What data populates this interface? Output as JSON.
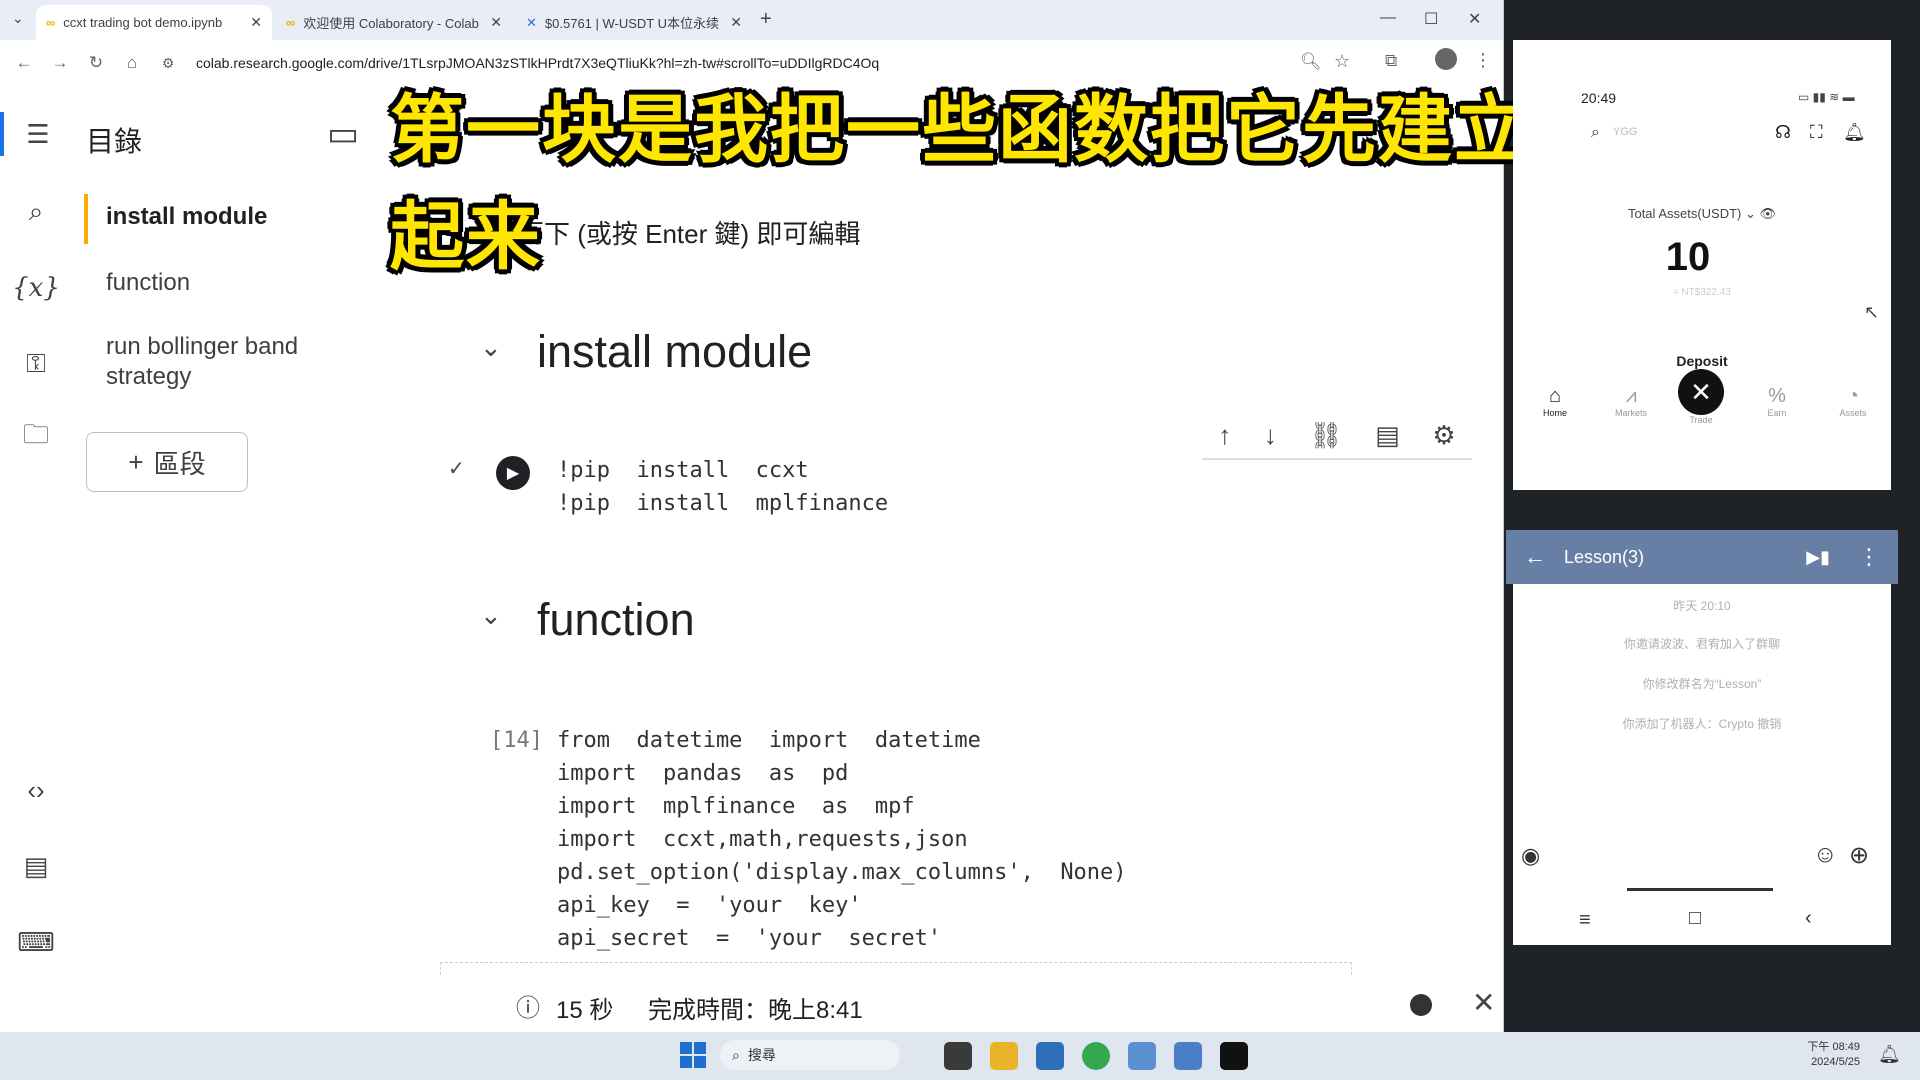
{
  "browser": {
    "tabs": [
      {
        "title": "ccxt trading bot demo.ipynb",
        "icon": "colab-icon",
        "active": true
      },
      {
        "title": "欢迎使用 Colaboratory - Colab",
        "icon": "colab-icon",
        "active": false
      },
      {
        "title": "$0.5761 | W-USDT U本位永续",
        "icon": "exchange-icon",
        "active": false
      }
    ],
    "new_tab": "+",
    "url": "colab.research.google.com/drive/1TLsrpJMOAN3zSTlkHPrdt7X3eQTliuKk?hl=zh-tw#scrollTo=uDDIlgRDC4Oq"
  },
  "toc": {
    "title": "目錄",
    "items": [
      {
        "label": "install module"
      },
      {
        "label": "function"
      },
      {
        "label": "run bollinger band strategy"
      }
    ],
    "add_section": "區段"
  },
  "notebook": {
    "edit_hint": "按兩下 (或按 Enter 鍵) 即可編輯",
    "section1": "install module",
    "cell1_lines": [
      "!pip  install  ccxt",
      "!pip  install  mplfinance"
    ],
    "section2": "function",
    "cell2_count": "[14]",
    "cell2_lines": [
      "from  datetime  import  datetime",
      "import  pandas  as  pd",
      "import  mplfinance  as  mpf",
      "import  ccxt,math,requests,json",
      "pd.set_option('display.max_columns',  None)",
      "api_key  =  'your  key'",
      "api_secret  =  'your  secret'"
    ],
    "status_duration": "15 秒",
    "status_done": "完成時間：晚上8:41"
  },
  "subtitle": "第一块是我把一些函数把它先建立起来",
  "phone": {
    "time": "20:49",
    "search_placeholder": "YGG",
    "total_assets_label": "Total Assets(USDT)",
    "total_assets_value": "10",
    "total_assets_sub": "≈ NT$322.43",
    "deposit_label": "Deposit",
    "nav": [
      "Home",
      "Markets",
      "Trade",
      "Earn",
      "Assets"
    ]
  },
  "chat": {
    "title": "Lesson(3)",
    "messages": [
      "昨天 20:10",
      "你邀请波波、君宥加入了群聊",
      "你修改群名为“Lesson”",
      "你添加了机器人：Crypto 撤销"
    ]
  },
  "taskbar": {
    "search": "搜尋",
    "clock_time": "下午 08:49",
    "clock_date": "2024/5/25"
  },
  "colors": {
    "accent": "#f9ab00",
    "subtitle": "#ffe600",
    "chat_header": "#687fa5"
  }
}
